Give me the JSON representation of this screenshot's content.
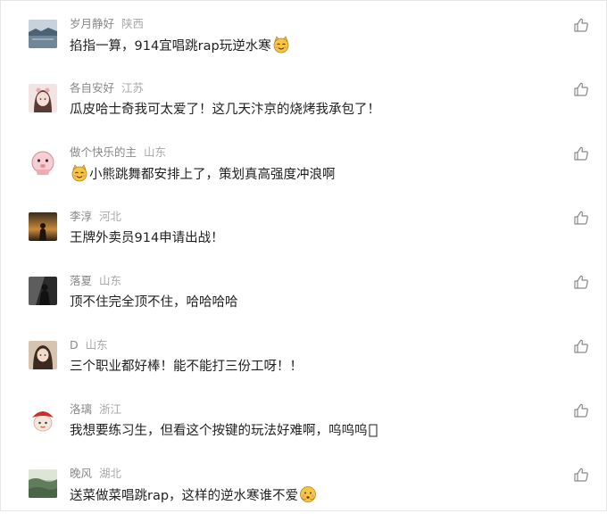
{
  "comments": [
    {
      "username": "岁月静好",
      "location": "陕西",
      "avatar_icon": "lake-landscape-avatar",
      "avatar_colors": [
        "#4b6274",
        "#8fa4b3"
      ],
      "text_before": "掐指一算，914宜唱跳rap玩逆水寒",
      "emoji": "cat-smile-emoji",
      "text_after": ""
    },
    {
      "username": "各自安好",
      "location": "江苏",
      "avatar_icon": "girl-portrait-avatar",
      "avatar_colors": [
        "#f3d6d8",
        "#5a3b34"
      ],
      "text_before": "瓜皮哈士奇我可太爱了！这几天汴京的烧烤我承包了！",
      "emoji": "",
      "text_after": ""
    },
    {
      "username": "做个快乐的主",
      "location": "山东",
      "avatar_icon": "cartoon-face-avatar",
      "avatar_colors": [
        "#f7ccd2",
        "#ffffff"
      ],
      "text_before": "",
      "emoji": "cat-smile-emoji",
      "text_after": "小熊跳舞都安排上了，策划真高强度冲浪啊"
    },
    {
      "username": "李淳",
      "location": "河北",
      "avatar_icon": "sunset-silhouette-avatar",
      "avatar_colors": [
        "#2a1e14",
        "#c98a3a"
      ],
      "text_before": "王牌外卖员914申请出战！",
      "emoji": "",
      "text_after": ""
    },
    {
      "username": "落夏",
      "location": "山东",
      "avatar_icon": "dark-figure-avatar",
      "avatar_colors": [
        "#222222",
        "#bdbdbd"
      ],
      "text_before": "顶不住完全顶不住，哈哈哈哈",
      "emoji": "",
      "text_after": ""
    },
    {
      "username": "D",
      "location": "山东",
      "avatar_icon": "girl-longhair-avatar",
      "avatar_colors": [
        "#d7c3b0",
        "#3a2a22"
      ],
      "text_before": "三个职业都好棒！能不能打三份工呀！！",
      "emoji": "",
      "text_after": ""
    },
    {
      "username": "洛璃",
      "location": "浙江",
      "avatar_icon": "red-hat-cartoon-avatar",
      "avatar_colors": [
        "#c9302c",
        "#f3e6dc"
      ],
      "text_before": "我想要练习生，但看这个按键的玩法好难啊，呜呜呜",
      "emoji": "missing-glyph-box",
      "text_after": ""
    },
    {
      "username": "晚风",
      "location": "湖北",
      "avatar_icon": "green-field-avatar",
      "avatar_colors": [
        "#5f7d5a",
        "#b9c9b0"
      ],
      "text_before": "送菜做菜唱跳rap，这样的逆水寒谁不爱",
      "emoji": "shy-face-emoji",
      "text_after": ""
    }
  ],
  "like_icon": "thumbs-up-outline-icon",
  "colors": {
    "username": "#888888",
    "location": "#a8a8a8",
    "text": "#1f1f1f",
    "like_icon": "#8a8a8a",
    "emoji_yellow": "#f6c642"
  }
}
